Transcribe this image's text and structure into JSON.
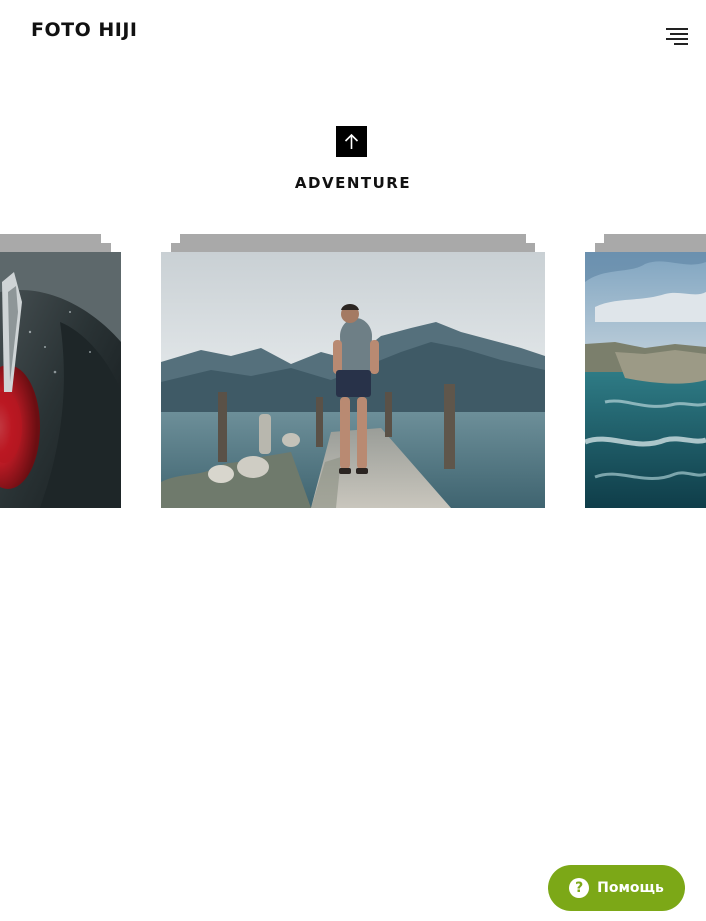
{
  "header": {
    "brand": "FOTO HIJI",
    "menu_icon": "hamburger-menu-icon"
  },
  "gallery": {
    "up_icon": "arrow-up-icon",
    "title": "ADVENTURE",
    "stack_color": "#a9a9a9",
    "photos": [
      {
        "name": "car-taillight-photo",
        "subject": "black car with red tail light"
      },
      {
        "name": "man-on-pier-photo",
        "subject": "man walking on a stone pier toward a mountain lake"
      },
      {
        "name": "ocean-coast-photo",
        "subject": "turquoise sea with rocky coastline"
      }
    ]
  },
  "help_widget": {
    "label": "Помощь",
    "icon": "question-mark-icon",
    "icon_glyph": "?",
    "color": "#7ca817"
  }
}
